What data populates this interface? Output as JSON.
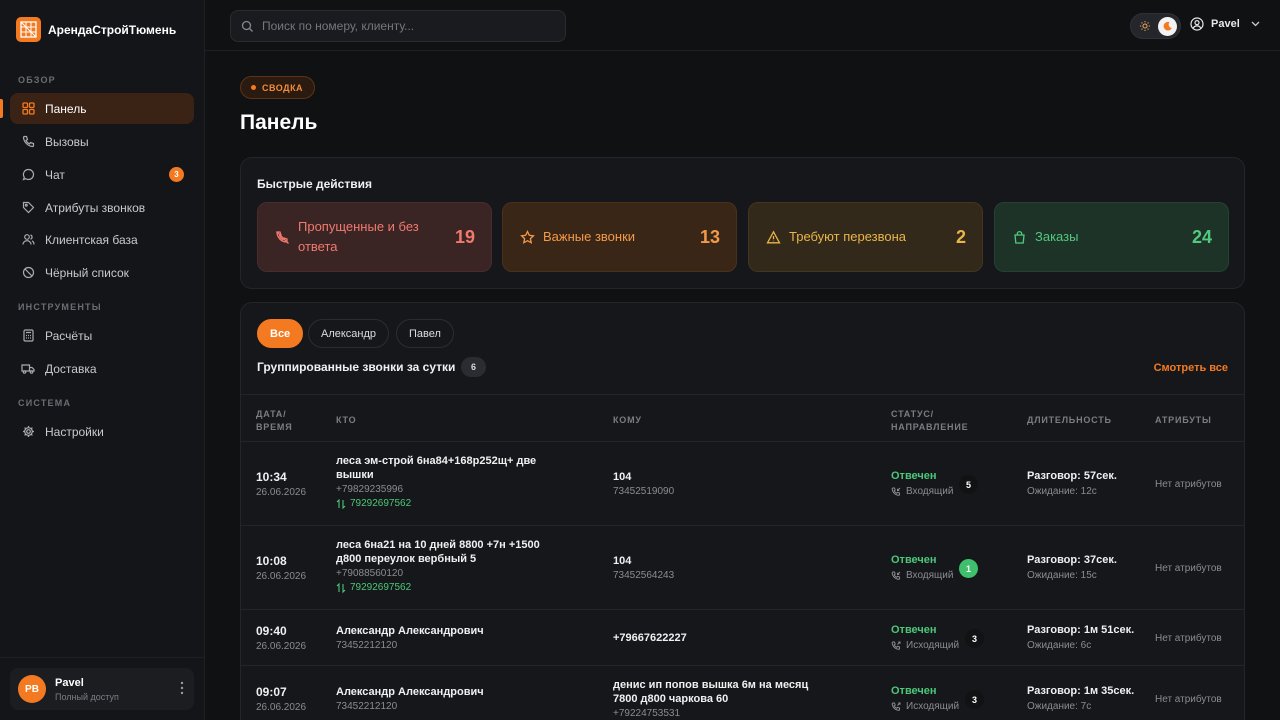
{
  "app": {
    "brand": "АрендаСтройТюмень"
  },
  "sidebar": {
    "sections": [
      {
        "label": "ОБЗОР"
      },
      {
        "label": "ИНСТРУМЕНТЫ"
      },
      {
        "label": "СИСТЕМА"
      }
    ],
    "items": [
      {
        "label": "Панель",
        "icon": "dashboard-icon",
        "active": true
      },
      {
        "label": "Вызовы",
        "icon": "phone-icon"
      },
      {
        "label": "Чат",
        "icon": "chat-icon",
        "badge": "3"
      },
      {
        "label": "Атрибуты звонков",
        "icon": "tag-icon"
      },
      {
        "label": "Клиентская база",
        "icon": "users-icon"
      },
      {
        "label": "Чёрный список",
        "icon": "ban-icon"
      },
      {
        "label": "Расчёты",
        "icon": "calculator-icon"
      },
      {
        "label": "Доставка",
        "icon": "truck-icon"
      },
      {
        "label": "Настройки",
        "icon": "gear-icon"
      }
    ],
    "user": {
      "initials": "PB",
      "name": "Pavel",
      "role": "Полный доступ"
    }
  },
  "topbar": {
    "search_placeholder": "Поиск по номеру, клиенту...",
    "account_name": "Pavel"
  },
  "header": {
    "pill": "СВОДКА",
    "title": "Панель"
  },
  "quick_actions": {
    "title": "Быстрые действия",
    "tiles": [
      {
        "label": "Пропущенные и без ответа",
        "count": "19",
        "icon": "missed-call-icon",
        "color": "#f07a6e"
      },
      {
        "label": "Важные звонки",
        "count": "13",
        "icon": "star-icon",
        "color": "#f29a4a"
      },
      {
        "label": "Требуют перезвона",
        "count": "2",
        "icon": "warning-icon",
        "color": "#e9b54a"
      },
      {
        "label": "Заказы",
        "count": "24",
        "icon": "bag-icon",
        "color": "#52c97e"
      }
    ]
  },
  "calls": {
    "filters": [
      "Все",
      "Александр",
      "Павел"
    ],
    "active_filter": "Все",
    "title": "Группированные звонки за сутки",
    "count": "6",
    "view_all": "Смотреть все",
    "columns": {
      "datetime_1": "ДАТА/",
      "datetime_2": "ВРЕМЯ",
      "who": "КТО",
      "to": "КОМУ",
      "status_1": "СТАТУС/",
      "status_2": "НАПРАВЛЕНИЕ",
      "duration": "ДЛИТЕЛЬНОСТЬ",
      "attributes": "АТРИБУТЫ"
    },
    "rows": [
      {
        "time": "10:34",
        "date": "26.06.2026",
        "who_name": "леса эм-строй 6на84+168р252щ+ две вышки",
        "who_phone": "+79829235996",
        "transfer": "79292697562",
        "to_main": "104",
        "to_sub": "73452519090",
        "status": "Отвечен",
        "direction": "Входящий",
        "count": "5",
        "count_green": false,
        "talk": "Разговор: 57сек.",
        "wait": "Ожидание: 12с",
        "attributes": "Нет атрибутов"
      },
      {
        "time": "10:08",
        "date": "26.06.2026",
        "who_name": "леса 6на21 на 10 дней 8800 +7н +1500 д800 переулок вербный 5",
        "who_phone": "+79088560120",
        "transfer": "79292697562",
        "to_main": "104",
        "to_sub": "73452564243",
        "status": "Отвечен",
        "direction": "Входящий",
        "count": "1",
        "count_green": true,
        "talk": "Разговор: 37сек.",
        "wait": "Ожидание: 15с",
        "attributes": "Нет атрибутов"
      },
      {
        "time": "09:40",
        "date": "26.06.2026",
        "who_name": "Александр Александрович",
        "who_phone": "73452212120",
        "transfer": "",
        "to_main": "+79667622227",
        "to_sub": "",
        "status": "Отвечен",
        "direction": "Исходящий",
        "count": "3",
        "count_green": false,
        "talk": "Разговор: 1м 51сек.",
        "wait": "Ожидание: 6с",
        "attributes": "Нет атрибутов"
      },
      {
        "time": "09:07",
        "date": "26.06.2026",
        "who_name": "Александр Александрович",
        "who_phone": "73452212120",
        "transfer": "",
        "to_main": "денис ип попов вышка 6м на месяц 7800 д800 чаркова 60",
        "to_sub": "+79224753531",
        "status": "Отвечен",
        "direction": "Исходящий",
        "count": "3",
        "count_green": false,
        "talk": "Разговор: 1м 35сек.",
        "wait": "Ожидание: 7с",
        "attributes": "Нет атрибутов"
      }
    ]
  },
  "colors": {
    "accent": "#f47a22",
    "success": "#4cc77a",
    "background": "#101113"
  }
}
